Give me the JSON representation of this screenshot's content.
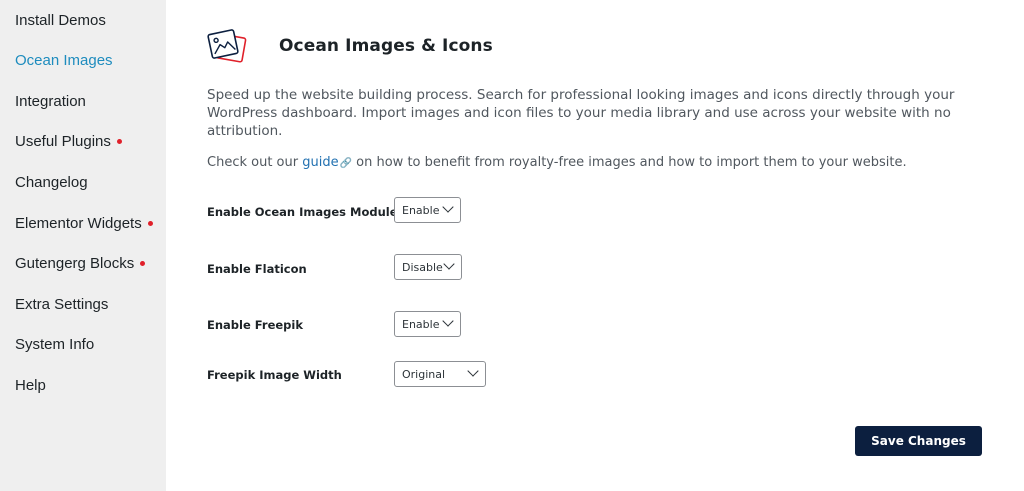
{
  "sidebar": {
    "items": [
      {
        "label": "Install Demos",
        "badge": false
      },
      {
        "label": "Ocean Images",
        "badge": false,
        "active": true
      },
      {
        "label": "Integration",
        "badge": false
      },
      {
        "label": "Useful Plugins",
        "badge": true
      },
      {
        "label": "Changelog",
        "badge": false
      },
      {
        "label": "Elementor Widgets",
        "badge": true
      },
      {
        "label": "Gutengerg Blocks",
        "badge": true
      },
      {
        "label": "Extra Settings",
        "badge": false
      },
      {
        "label": "System Info",
        "badge": false
      },
      {
        "label": "Help",
        "badge": false
      }
    ],
    "active_color": "#1e8cbe",
    "badge_color": "#e0202a"
  },
  "main": {
    "icon": "images-icon",
    "title": "Ocean Images & Icons",
    "description": "Speed up the website building process. Search for professional looking images and icons directly through your WordPress dashboard. Import images and icon files to your media library and use across your website with no attribution.",
    "guide": {
      "prefix": "Check out our ",
      "link_text": "guide",
      "suffix": " on how to benefit from royalty-free images and how to import them to your website."
    },
    "fields": [
      {
        "label": "Enable Ocean Images Module",
        "value": "Enable"
      },
      {
        "label": "Enable Flaticon",
        "value": "Disable"
      },
      {
        "label": "Enable Freepik",
        "value": "Enable"
      },
      {
        "label": "Freepik Image Width",
        "value": "Original"
      }
    ],
    "save_label": "Save Changes",
    "button_color": "#0c1f3f"
  }
}
